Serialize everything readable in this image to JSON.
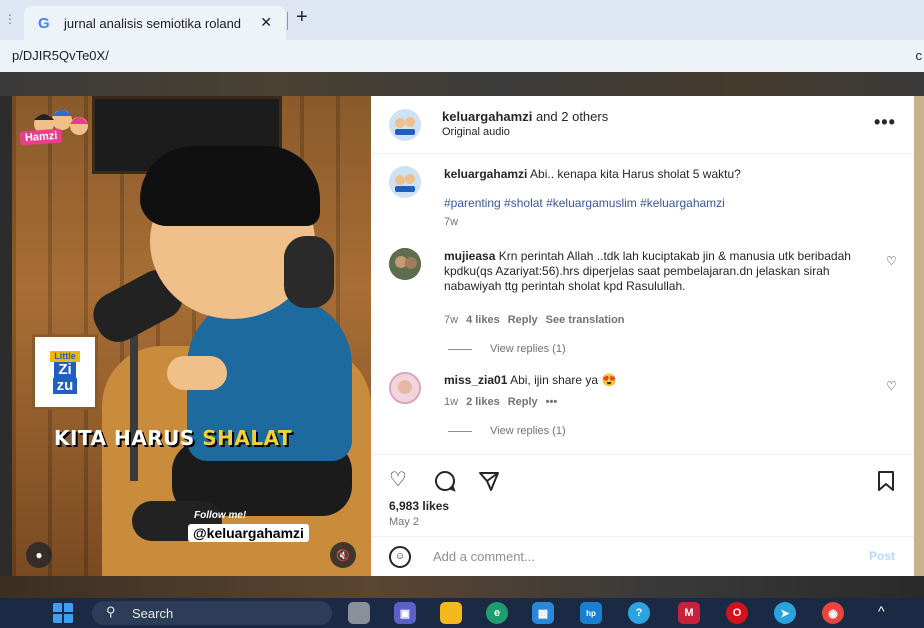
{
  "browser": {
    "tab_title": "jurnal analisis semiotika roland",
    "tab_close": "✕",
    "new_tab": "+",
    "url": "p/DJIR5QvTe0X/"
  },
  "video": {
    "logo_text": "Hamzi",
    "badge_small": "Little",
    "badge_zi": "Zi",
    "badge_zu": "zu",
    "caption_white": "KITA HARUS ",
    "caption_highlight": "SHALAT",
    "follow_text": "Follow me!",
    "handle_text": "@keluargahamzi"
  },
  "post": {
    "header_user": "keluargahamzi",
    "header_others": " and 2 others",
    "header_sub": "Original audio",
    "caption_user": "keluargahamzi",
    "caption_text": " Abi.. kenapa kita Harus sholat 5 waktu?",
    "hashtags": "#parenting #sholat #keluargamuslim #keluargahamzi",
    "caption_time": "7w",
    "comments": [
      {
        "user": "mujieasa",
        "text": " Krn perintah Allah ..tdk lah kuciptakab jin & manusia utk beribadah kpdku(qs Azariyat:56).hrs diperjelas saat pembelajaran.dn jelaskan sirah nabawiyah ttg perintah sholat kpd Rasulullah.",
        "time": "7w",
        "likes": "4 likes",
        "reply": "Reply",
        "translation": "See translation",
        "view_replies": "View replies (1)"
      },
      {
        "user": "miss_zia01",
        "text": " Abi, ijin share ya 😍",
        "time": "1w",
        "likes": "2 likes",
        "reply": "Reply",
        "more": "•••",
        "view_replies": "View replies (1)"
      }
    ],
    "likes": "6,983 likes",
    "date": "May 2",
    "comment_placeholder": "Add a comment...",
    "post_label": "Post"
  },
  "taskbar": {
    "search_label": "Search"
  },
  "colors": {
    "link": "#385898",
    "post_disabled": "#b3dbff",
    "caption_highlight": "#f3cf3a"
  }
}
